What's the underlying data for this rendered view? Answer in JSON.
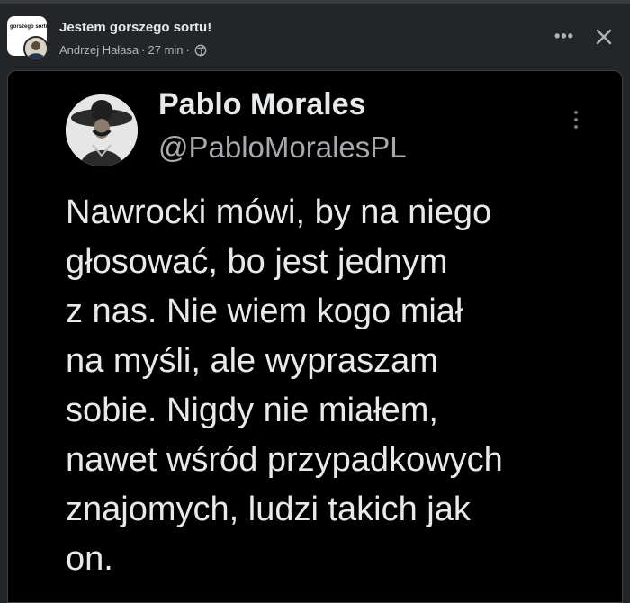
{
  "post": {
    "group_name": "Jestem gorszego sortu!",
    "group_avatar_text": "gorszego sortu",
    "author": "Andrzej Hałasa",
    "time": "27 min",
    "separator": "·",
    "visibility_icon": "globe-icon"
  },
  "header_actions": {
    "more_label": "•••",
    "more_icon": "more-horizontal-icon",
    "close_icon": "close-icon"
  },
  "tweet": {
    "display_name": "Pablo Morales",
    "handle": "@PabloMoralesPL",
    "more_icon": "more-vertical-icon",
    "text_lines": [
      "Nawrocki mówi, by na niego",
      "głosować, bo jest jednym",
      "z nas. Nie wiem kogo miał",
      "na myśli, ale wypraszam",
      "sobie. Nigdy nie miałem,",
      "nawet wśród przypadkowych",
      "znajomych, ludzi takich jak",
      "on."
    ]
  },
  "colors": {
    "page_bg": "#242526",
    "tweet_bg": "#000000",
    "primary_text": "#e4e6eb",
    "secondary_text": "#b0b3b8",
    "tweet_handle": "#a7a9ac"
  }
}
